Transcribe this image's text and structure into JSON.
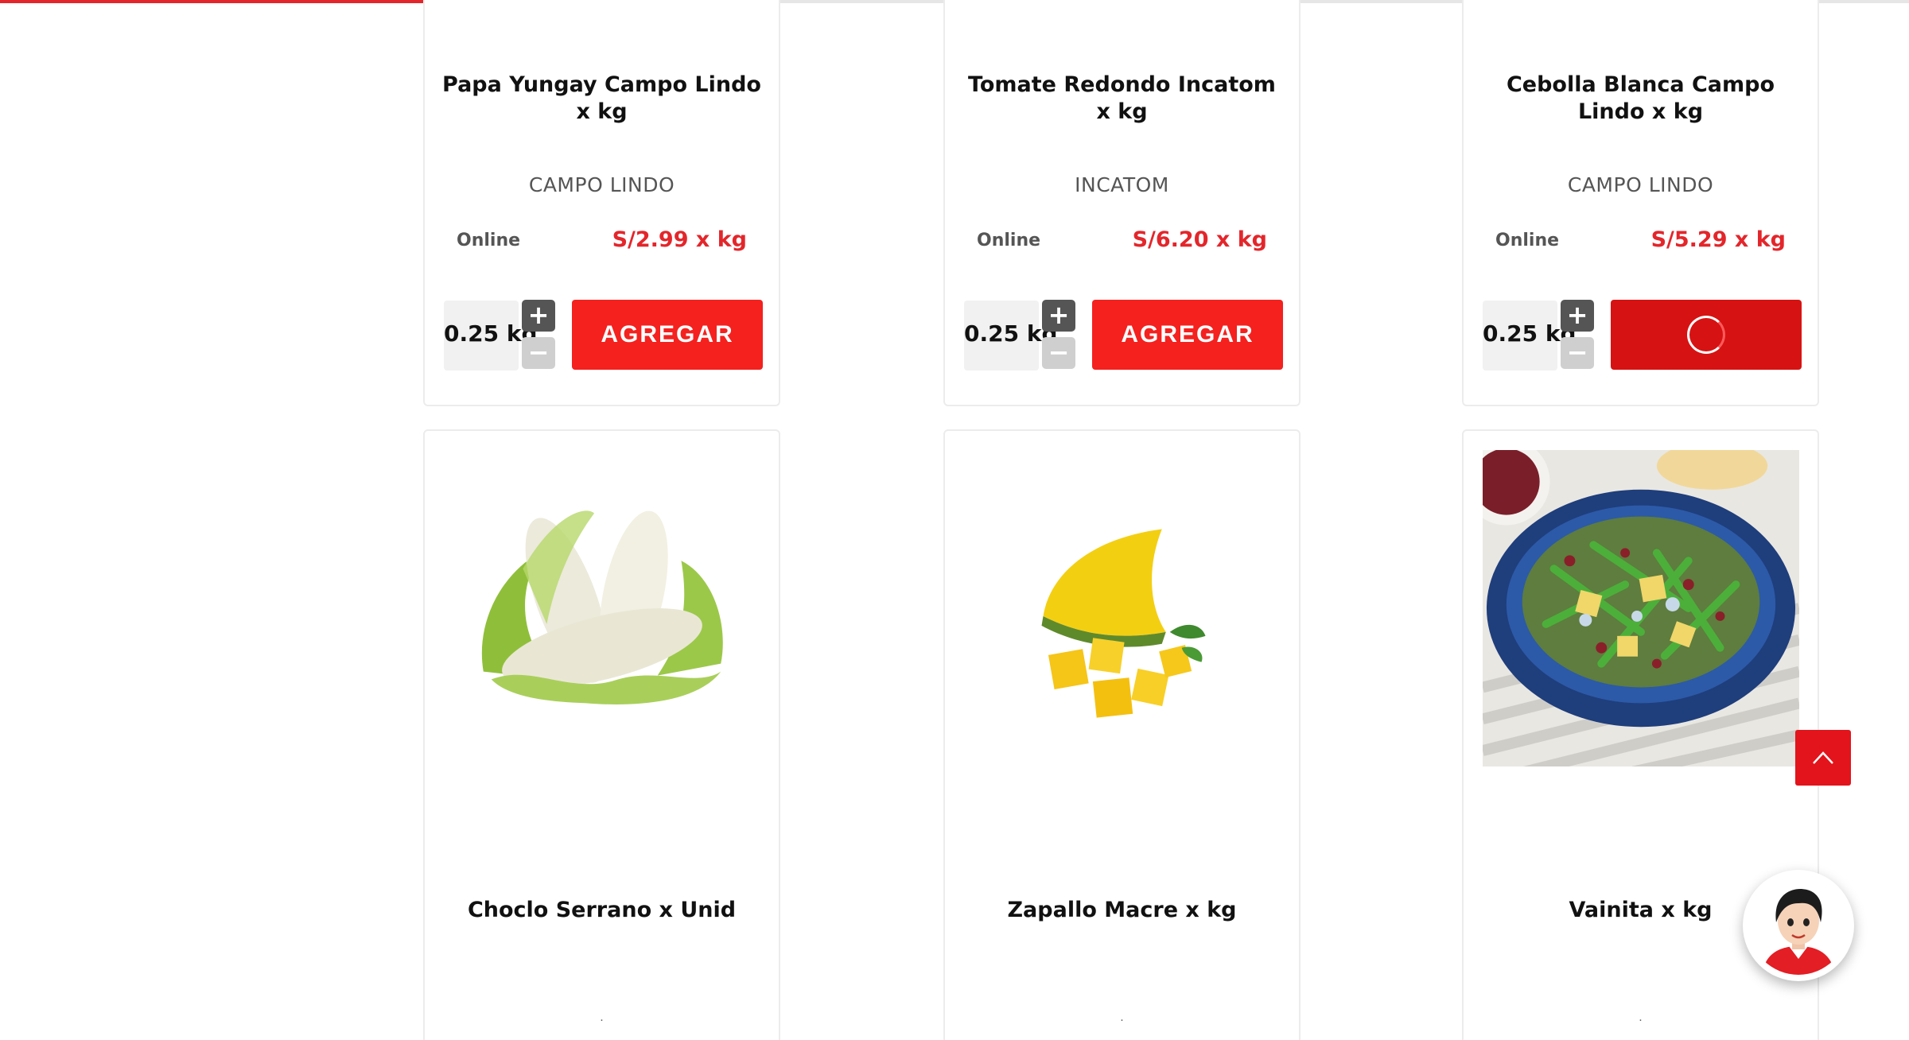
{
  "progress_bar": {
    "fraction": 0.26,
    "color": "#e3262b"
  },
  "products": [
    {
      "name": "Papa Yungay Campo Lindo x kg",
      "brand": "CAMPO LINDO",
      "channel": "Online",
      "price": "S/2.99 x kg",
      "quantity": "0.25 kg",
      "add_label": "AGREGAR",
      "state": "idle"
    },
    {
      "name": "Tomate Redondo Incatom x kg",
      "brand": "INCATOM",
      "channel": "Online",
      "price": "S/6.20 x kg",
      "quantity": "0.25 kg",
      "add_label": "AGREGAR",
      "state": "idle"
    },
    {
      "name": "Cebolla Blanca Campo Lindo x kg",
      "brand": "CAMPO LINDO",
      "channel": "Online",
      "price": "S/5.29 x kg",
      "quantity": "0.25 kg",
      "add_label": "",
      "state": "loading"
    },
    {
      "name": "Choclo Serrano x Unid",
      "brand": "."
    },
    {
      "name": "Zapallo Macre x kg",
      "brand": "."
    },
    {
      "name": "Vainita x kg",
      "brand": "."
    }
  ],
  "stepper": {
    "plus": "+",
    "minus": "−"
  },
  "icons": {
    "scroll_top": "chevron-up-icon",
    "assistant": "assistant-avatar-icon"
  },
  "colors": {
    "accent": "#e3262b",
    "button": "#f4211f",
    "button_loading": "#d71212"
  }
}
